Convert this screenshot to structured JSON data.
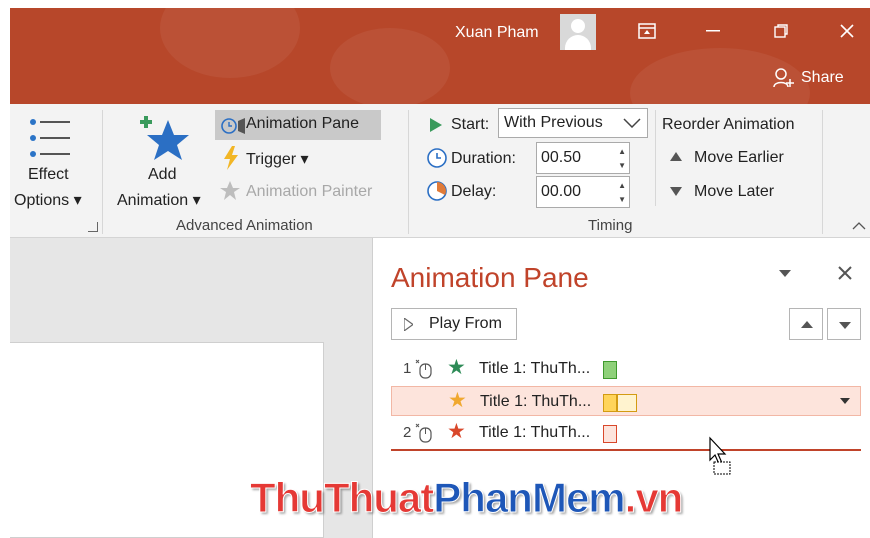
{
  "titlebar": {
    "user_name": "Xuan Pham",
    "share_label": "Share"
  },
  "ribbon": {
    "effect_options": {
      "line1": "Effect",
      "line2": "Options ▾"
    },
    "add_animation": {
      "line1": "Add",
      "line2": "Animation ▾"
    },
    "animation_pane_label": "Animation Pane",
    "trigger_label": "Trigger ▾",
    "animation_painter_label": "Animation Painter",
    "advanced_animation_label": "Advanced Animation",
    "start_label": "Start:",
    "start_value": "With Previous",
    "duration_label": "Duration:",
    "duration_value": "00.50",
    "delay_label": "Delay:",
    "delay_value": "00.00",
    "timing_label": "Timing",
    "reorder_label": "Reorder Animation",
    "move_earlier_label": "Move Earlier",
    "move_later_label": "Move Later"
  },
  "pane": {
    "title": "Animation Pane",
    "play_from_label": "Play From",
    "rows": [
      {
        "number": "1",
        "label": "Title 1: ThuTh...",
        "star_color": "#2e8b57"
      },
      {
        "number": "",
        "label": "Title 1: ThuTh...",
        "star_color": "#f0a830"
      },
      {
        "number": "2",
        "label": "Title 1: ThuTh...",
        "star_color": "#d9482b"
      }
    ]
  },
  "watermark": {
    "part1": "ThuThuat",
    "part2": "PhanMem",
    "part3": ".vn"
  },
  "colors": {
    "accent": "#b7472a",
    "pane_title": "#c0432a",
    "selection": "#fde4dc"
  }
}
